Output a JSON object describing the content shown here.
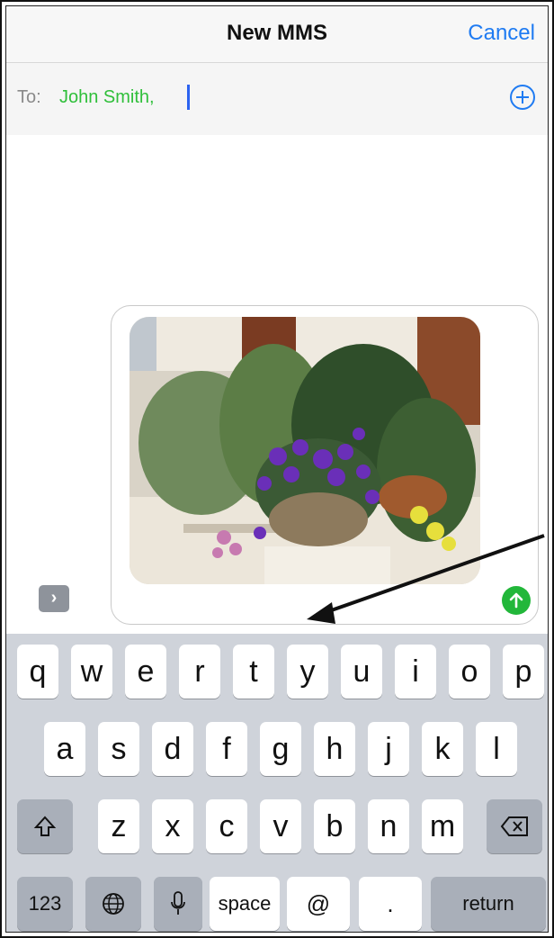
{
  "header": {
    "title": "New MMS",
    "cancel_label": "Cancel"
  },
  "to_field": {
    "label": "To:",
    "recipient": "John Smith,"
  },
  "keyboard": {
    "row1": [
      "q",
      "w",
      "e",
      "r",
      "t",
      "y",
      "u",
      "i",
      "o",
      "p"
    ],
    "row2": [
      "a",
      "s",
      "d",
      "f",
      "g",
      "h",
      "j",
      "k",
      "l"
    ],
    "row3": [
      "z",
      "x",
      "c",
      "v",
      "b",
      "n",
      "m"
    ],
    "numbers_label": "123",
    "space_label": "space",
    "at_label": "@",
    "period_label": ".",
    "return_label": "return"
  },
  "colors": {
    "accent": "#1f7bf2",
    "recipient": "#2fbf3a",
    "send": "#22b73a"
  },
  "icons": {
    "expand": "chevron-right-icon",
    "send": "arrow-up-icon",
    "add": "plus-circle-icon",
    "shift": "shift-icon",
    "delete": "backspace-icon",
    "globe": "globe-icon",
    "mic": "microphone-icon"
  }
}
